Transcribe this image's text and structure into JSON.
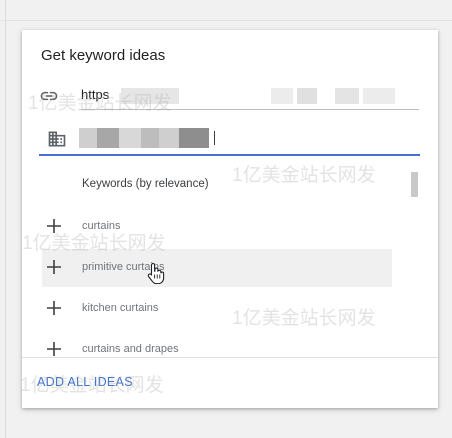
{
  "panel": {
    "title": "Get keyword ideas",
    "url_value": "https",
    "list_header": "Keywords (by relevance)",
    "add_all_label": "ADD ALL IDEAS"
  },
  "ideas": [
    {
      "label": "curtains"
    },
    {
      "label": "primitive curtains"
    },
    {
      "label": "kitchen curtains"
    },
    {
      "label": "curtains and drapes"
    }
  ],
  "watermarks": [
    "1亿美金站长网发",
    "1亿美金站长网发",
    "1亿美金站长网发",
    "1亿美金站长网发",
    "1亿美金站长网发"
  ],
  "colors": {
    "accent": "#3b6fcf",
    "underline_active": "#4a6fd3"
  },
  "icons": {
    "url_field": "link-icon",
    "site_field": "building-icon",
    "add_idea": "plus-icon",
    "pointer": "hand-cursor-icon"
  }
}
